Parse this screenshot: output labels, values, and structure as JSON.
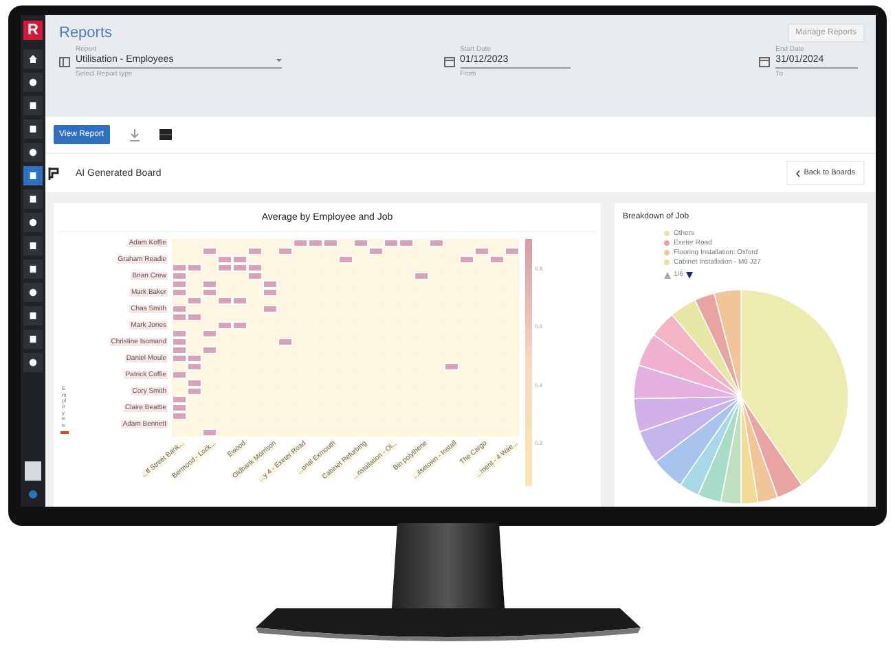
{
  "app": {
    "logo": "R"
  },
  "sidebar": {
    "items": [
      {
        "selected": false
      },
      {
        "selected": false
      },
      {
        "selected": false
      },
      {
        "selected": false
      },
      {
        "selected": false
      },
      {
        "selected": true
      },
      {
        "selected": false
      },
      {
        "selected": false
      },
      {
        "selected": false
      },
      {
        "selected": false
      },
      {
        "selected": false
      },
      {
        "selected": false
      },
      {
        "selected": false
      },
      {
        "selected": false
      }
    ]
  },
  "header": {
    "title": "Reports",
    "manage_button": "Manage Reports",
    "fields": [
      {
        "kind": "select",
        "label": "Report",
        "value": "Utilisation - Employees",
        "hint": "Select Report type"
      },
      {
        "kind": "date",
        "label": "Start Date",
        "value": "01/12/2023",
        "hint": "From"
      },
      {
        "kind": "date",
        "label": "End Date",
        "value": "31/01/2024",
        "hint": "To"
      }
    ]
  },
  "toolbar": {
    "view_button": "View Report"
  },
  "board": {
    "title": "AI Generated Board",
    "back_button": "Back to Boards"
  },
  "heatmap": {
    "title": "Average by Employee and Job",
    "legend_label": "Employee",
    "rows": [
      "Adam Koffie",
      "Graham Readie",
      "Brian Crew",
      "Mark Baker",
      "Chas Smith",
      "Mark Jones",
      "Christine Isomand",
      "Daniel Moule",
      "Patrick Coffie",
      "Cory Smith",
      "Claire Beattie",
      "Adam Bennett"
    ],
    "columns": [
      "...ff Street Bank...",
      "Bermond - Lock...",
      "Ewood",
      "Oldbank Morrison",
      "...y 4 - Exeter Road",
      "...onal Exmouth",
      "Cabinet Refurbing",
      "...nstallation - Ol...",
      "Bin polythene",
      "...ilsetown - Install",
      "The Cargo",
      "...ment - 4 Wae..."
    ],
    "scale_ticks": [
      "0.8",
      "0.6",
      "0.4",
      "0.2"
    ]
  },
  "pie": {
    "title": "Breakdown of Job",
    "pager": "1/6",
    "legend": [
      {
        "label": "Others",
        "color": "#e8e6a4"
      },
      {
        "label": "Exeter Road",
        "color": "#e8a4a0"
      },
      {
        "label": "Flooring Installation: Oxford",
        "color": "#f2c49a"
      },
      {
        "label": "Cabinet Installation - M6 J27",
        "color": "#f2dc98"
      }
    ]
  }
}
